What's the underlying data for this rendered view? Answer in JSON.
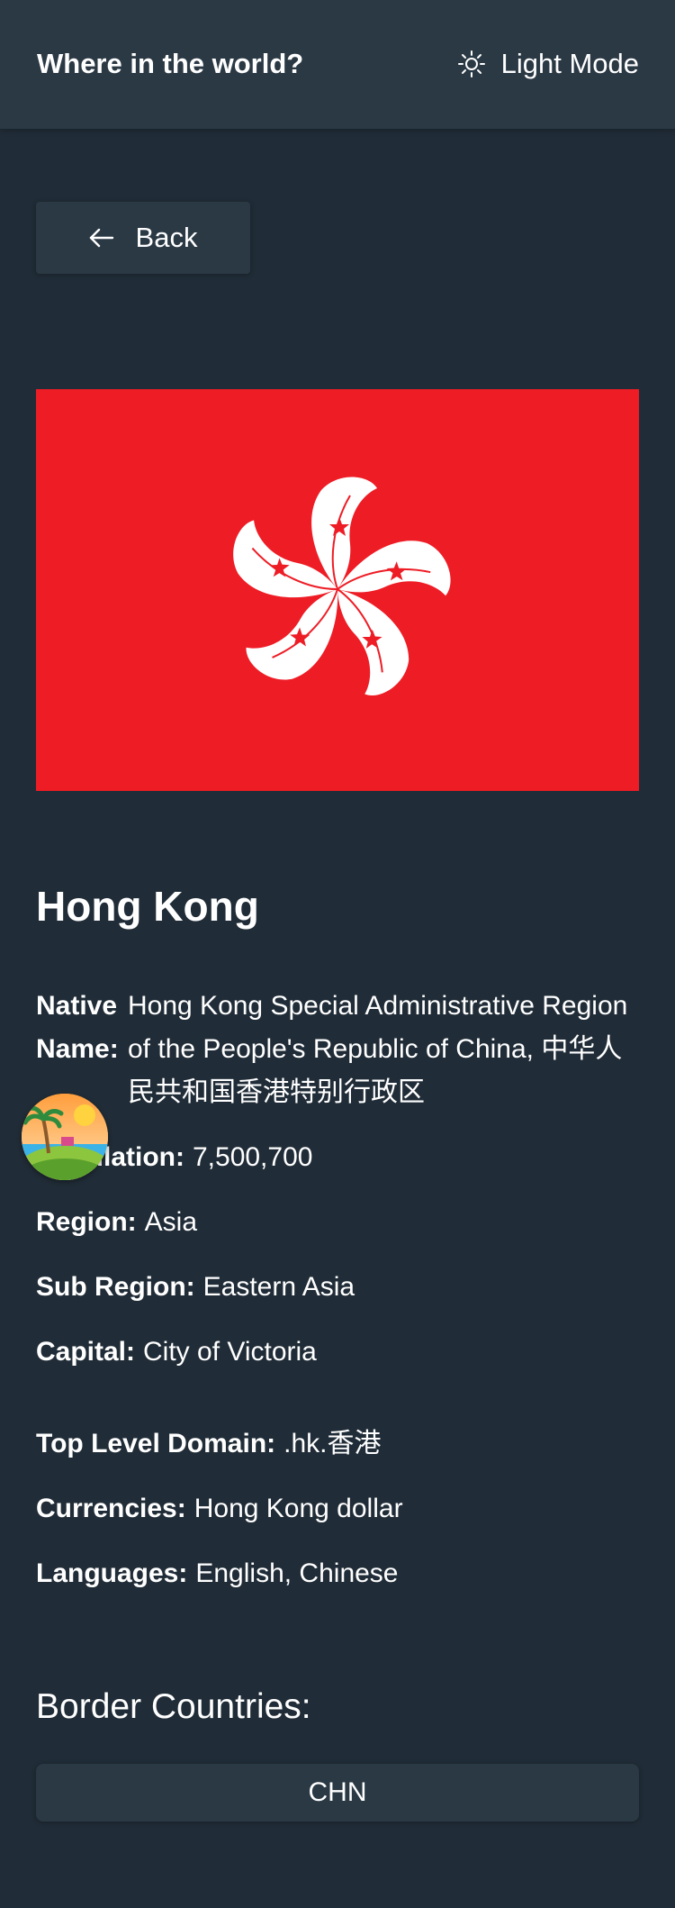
{
  "header": {
    "title": "Where in the world?",
    "theme_toggle_label": "Light Mode",
    "theme_icon": "sun-icon"
  },
  "back_button": {
    "label": "Back",
    "icon": "arrow-left-icon"
  },
  "flag": {
    "icon": "hong-kong-flag",
    "background_color": "#ee1c25"
  },
  "country": {
    "name": "Hong Kong",
    "details_primary": [
      {
        "key": "Native Name:",
        "value": "Hong Kong Special Administrative Region of the People's Republic of China, 中华人民共和国香港特别行政区"
      },
      {
        "key": "Population:",
        "value": "7,500,700"
      },
      {
        "key": "Region:",
        "value": "Asia"
      },
      {
        "key": "Sub Region:",
        "value": "Eastern Asia"
      },
      {
        "key": "Capital:",
        "value": "City of Victoria"
      }
    ],
    "details_secondary": [
      {
        "key": "Top Level Domain:",
        "value": ".hk.香港"
      },
      {
        "key": "Currencies:",
        "value": "Hong Kong dollar"
      },
      {
        "key": "Languages:",
        "value": "English, Chinese"
      }
    ]
  },
  "border": {
    "title": "Border Countries:",
    "countries": [
      "CHN"
    ]
  },
  "overlay": {
    "icon": "beach-island-avatar-icon"
  },
  "colors": {
    "background": "#202c37",
    "surface": "#2b3945",
    "text": "#ffffff"
  }
}
